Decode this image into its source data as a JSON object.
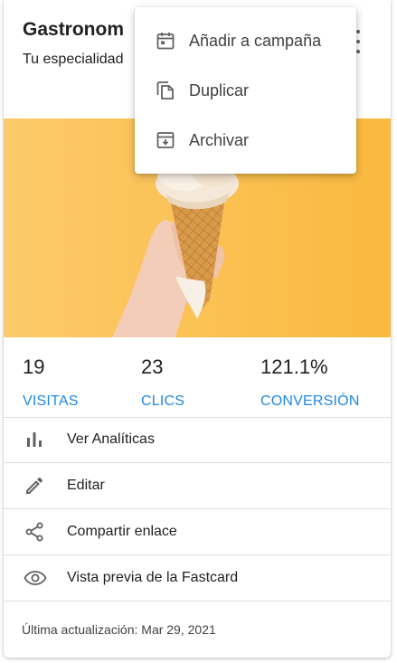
{
  "card": {
    "title": "Gastronom",
    "subtitle": "Tu especialidad"
  },
  "menu": {
    "items": [
      {
        "label": "Añadir a campaña",
        "icon": "calendar-icon"
      },
      {
        "label": "Duplicar",
        "icon": "copy-icon"
      },
      {
        "label": "Archivar",
        "icon": "archive-icon"
      }
    ]
  },
  "stats": [
    {
      "value": "19",
      "label": "VISITAS"
    },
    {
      "value": "23",
      "label": "CLICS"
    },
    {
      "value": "121.1%",
      "label": "CONVERSIÓN"
    }
  ],
  "actions": [
    {
      "label": "Ver Analíticas",
      "icon": "bar-chart-icon"
    },
    {
      "label": "Editar",
      "icon": "pencil-icon"
    },
    {
      "label": "Compartir enlace",
      "icon": "share-icon"
    },
    {
      "label": "Vista previa de la Fastcard",
      "icon": "eye-icon"
    }
  ],
  "footer": {
    "updated": "Última actualización: Mar 29, 2021"
  },
  "colors": {
    "accent": "#1e88e5",
    "hero_background": "#fbbd4c"
  }
}
